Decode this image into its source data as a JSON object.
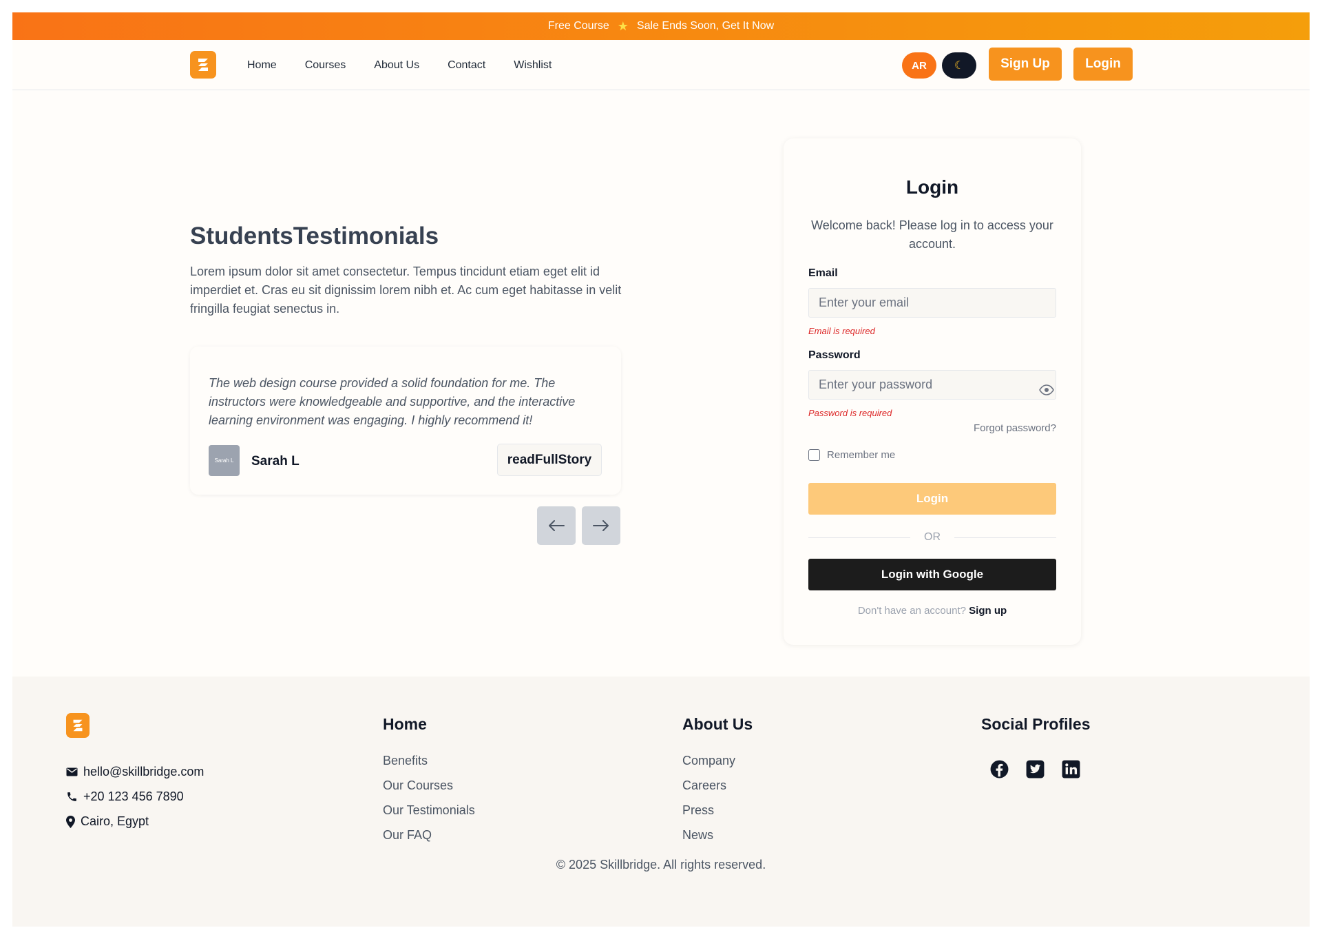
{
  "banner": {
    "left": "Free Course",
    "star_icon": "star-icon",
    "right": "Sale Ends Soon, Get It Now"
  },
  "nav": {
    "links": [
      "Home",
      "Courses",
      "About Us",
      "Contact",
      "Wishlist"
    ],
    "lang_button": "AR",
    "theme_icon": "moon-icon",
    "signup_label": "Sign Up",
    "login_label": "Login"
  },
  "testimonials": {
    "title": "StudentsTestimonials",
    "description": "Lorem ipsum dolor sit amet consectetur. Tempus tincidunt etiam eget elit id imperdiet et. Cras eu sit dignissim lorem nibh et. Ac cum eget habitasse in velit fringilla feugiat senectus in.",
    "card": {
      "quote": "The web design course provided a solid foundation for me. The instructors were knowledgeable and supportive, and the interactive learning environment was engaging. I highly recommend it!",
      "avatar_alt": "Sarah L",
      "name": "Sarah L",
      "button": "readFullStory"
    }
  },
  "login": {
    "title": "Login",
    "subtitle": "Welcome back! Please log in to access your account.",
    "email_label": "Email",
    "email_placeholder": "Enter your email",
    "email_error": "Email is required",
    "password_label": "Password",
    "password_placeholder": "Enter your password",
    "password_error": "Password is required",
    "forgot": "Forgot password?",
    "remember": "Remember me",
    "login_button": "Login",
    "or": "OR",
    "google_button": "Login with Google",
    "no_account": "Don't have an account?",
    "signup_link": "Sign up"
  },
  "footer": {
    "email": "hello@skillbridge.com",
    "phone": "+20 123 456 7890",
    "location": "Cairo, Egypt",
    "col1": {
      "title": "Home",
      "links": [
        "Benefits",
        "Our Courses",
        "Our Testimonials",
        "Our FAQ"
      ]
    },
    "col2": {
      "title": "About Us",
      "links": [
        "Company",
        "Careers",
        "Press",
        "News"
      ]
    },
    "col3": {
      "title": "Social Profiles",
      "icons": [
        "facebook-icon",
        "twitter-icon",
        "linkedin-icon"
      ]
    },
    "copyright": "© 2025 Skillbridge. All rights reserved."
  },
  "colors": {
    "brand": "#f7931e",
    "accent": "#f97316",
    "error": "#dc2626",
    "dark": "#1c1c1c"
  }
}
